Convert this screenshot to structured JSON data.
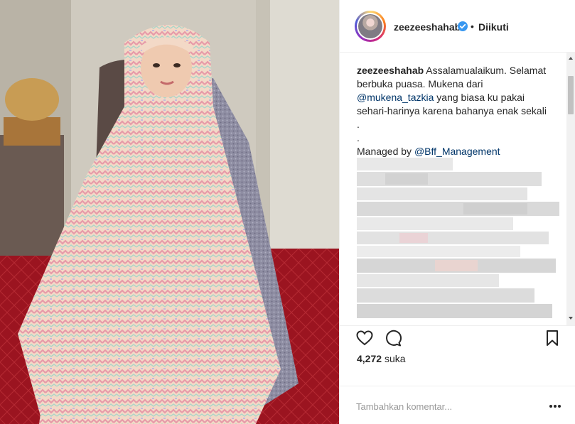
{
  "post": {
    "image_alt": "",
    "username": "zeezeeshahab",
    "verified_icon": "verified-badge-icon",
    "separator": "•",
    "follow_status": "Diikuti"
  },
  "caption": {
    "username": "zeezeeshahab",
    "line1": "Assalamualaikum. Selamat berbuka puasa. Mukena dari",
    "mention1": "@mukena_tazkia",
    "line2": "yang biasa ku pakai sehari-harinya karena bahanya enak sekali",
    "dot1": ".",
    "dot2": ".",
    "managed_prefix": "Managed by",
    "mention2": "@Bff_Management"
  },
  "actions": {
    "like_icon": "heart-icon",
    "comment_icon": "comment-icon",
    "save_icon": "bookmark-icon",
    "likes_count": "4,272",
    "likes_suffix": "suka"
  },
  "comment": {
    "placeholder": "Tambahkan komentar...",
    "more_icon": "more-options-icon"
  },
  "colors": {
    "text": "#262626",
    "link": "#003569",
    "verified": "#3897f0",
    "border": "#efefef",
    "placeholder": "#999999"
  }
}
